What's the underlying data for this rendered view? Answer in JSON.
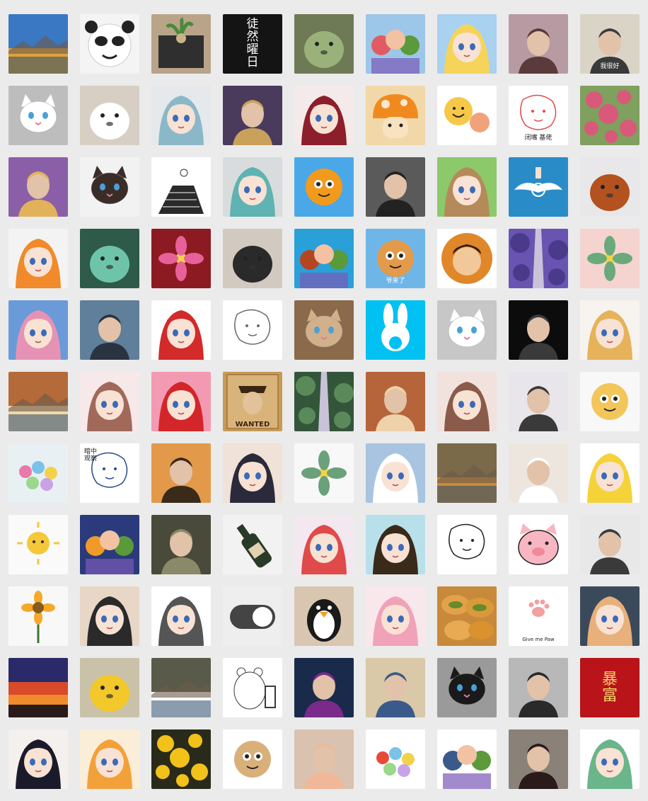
{
  "gallery": {
    "title": "",
    "columns": 9,
    "rows": 11,
    "tiles": [
      {
        "name": "blue-sky-lake-avatar",
        "bg": "#3a78c4",
        "accent": "#e0a23a",
        "shape": "landscape"
      },
      {
        "name": "panda-meme-avatar",
        "bg": "#f4f4f4",
        "accent": "#222222",
        "shape": "panda"
      },
      {
        "name": "potted-plant-table-avatar",
        "bg": "#b9a48a",
        "accent": "#2f2f2f",
        "shape": "plant"
      },
      {
        "name": "black-calligraphy-avatar",
        "bg": "#141414",
        "accent": "#ffffff",
        "shape": "text",
        "text": "徒\n然\n曜\n日"
      },
      {
        "name": "green-frog-plush-avatar",
        "bg": "#6d7a55",
        "accent": "#9ab27a",
        "shape": "blob"
      },
      {
        "name": "cartoon-kids-avatar",
        "bg": "#9cc7e8",
        "accent": "#e25a63",
        "shape": "group"
      },
      {
        "name": "sailor-moon-avatar",
        "bg": "#a9d1f0",
        "accent": "#f6d45a",
        "shape": "anime"
      },
      {
        "name": "girl-with-flower-avatar",
        "bg": "#b89aa3",
        "accent": "#5a3a3a",
        "shape": "person"
      },
      {
        "name": "old-portrait-meme-avatar",
        "bg": "#d9d4c6",
        "accent": "#3a3a3a",
        "shape": "person",
        "caption": "我很好"
      },
      {
        "name": "pixel-cat-avatar",
        "bg": "#bdbdbd",
        "accent": "#ffffff",
        "shape": "cat"
      },
      {
        "name": "white-pomeranian-avatar",
        "bg": "#d8cfc4",
        "accent": "#ffffff",
        "shape": "blob"
      },
      {
        "name": "white-hair-anime-girl-avatar",
        "bg": "#e5e9ec",
        "accent": "#8ab8c9",
        "shape": "anime"
      },
      {
        "name": "historical-general-avatar",
        "bg": "#4a3b5c",
        "accent": "#c9a15a",
        "shape": "person"
      },
      {
        "name": "red-anime-girl-avatar",
        "bg": "#f4eaea",
        "accent": "#8c1f2b",
        "shape": "anime"
      },
      {
        "name": "orange-mushroom-avatar",
        "bg": "#f2d8a8",
        "accent": "#f08a1e",
        "shape": "mushroom"
      },
      {
        "name": "cartoon-eggs-avatar",
        "bg": "#ffffff",
        "accent": "#f5c84a",
        "shape": "faces"
      },
      {
        "name": "doodle-girl-meme-avatar",
        "bg": "#ffffff",
        "accent": "#e04b4b",
        "shape": "doodle",
        "caption": "闭嘴 基佬"
      },
      {
        "name": "pink-blossom-tree-avatar",
        "bg": "#7fa05e",
        "accent": "#d9597a",
        "shape": "blossom"
      },
      {
        "name": "laughing-buddha-avatar",
        "bg": "#8b5fa8",
        "accent": "#e2b25a",
        "shape": "person"
      },
      {
        "name": "siamese-cat-avatar",
        "bg": "#f2f2f2",
        "accent": "#3a2d28",
        "shape": "cat"
      },
      {
        "name": "sketch-stairs-avatar",
        "bg": "#ffffff",
        "accent": "#333333",
        "shape": "stairs"
      },
      {
        "name": "miku-sketch-avatar",
        "bg": "#d9dcdc",
        "accent": "#5fb3b3",
        "shape": "anime"
      },
      {
        "name": "orange-mascot-avatar",
        "bg": "#4aa8e8",
        "accent": "#f39a1c",
        "shape": "mascot"
      },
      {
        "name": "sherlock-silhouette-avatar",
        "bg": "#5a5a5a",
        "accent": "#222222",
        "shape": "person"
      },
      {
        "name": "brown-hair-chibi-avatar",
        "bg": "#8cc96b",
        "accent": "#b58a5a",
        "shape": "anime"
      },
      {
        "name": "winged-compass-avatar",
        "bg": "#2a8cc7",
        "accent": "#ffffff",
        "shape": "compass"
      },
      {
        "name": "red-squirrel-avatar",
        "bg": "#e8e8ea",
        "accent": "#b3521f",
        "shape": "blob"
      },
      {
        "name": "orange-hair-anime-avatar",
        "bg": "#f3f3f3",
        "accent": "#f08a2a",
        "shape": "anime"
      },
      {
        "name": "green-blob-creature-avatar",
        "bg": "#2e5a4a",
        "accent": "#6ec4a8",
        "shape": "blob"
      },
      {
        "name": "pink-lily-bouquet-avatar",
        "bg": "#8c1a22",
        "accent": "#e8609a",
        "shape": "flower"
      },
      {
        "name": "fluffy-dog-bow-avatar",
        "bg": "#d2c9c0",
        "accent": "#2a2a2a",
        "shape": "blob"
      },
      {
        "name": "orange-sky-jump-avatar",
        "bg": "#2aa0d8",
        "accent": "#b4461f",
        "shape": "group"
      },
      {
        "name": "old-man-cloud-avatar",
        "bg": "#6fb6e8",
        "accent": "#e39a4a",
        "shape": "mascot",
        "caption": "爷来了"
      },
      {
        "name": "round-boy-emblem-avatar",
        "bg": "#ffffff",
        "accent": "#e0872a",
        "shape": "emblem"
      },
      {
        "name": "purple-forest-road-avatar",
        "bg": "#7a63c8",
        "accent": "#4a3a8a",
        "shape": "forest"
      },
      {
        "name": "pink-watercolor-avatar",
        "bg": "#f5d3cf",
        "accent": "#6aaa7a",
        "shape": "flower"
      },
      {
        "name": "pink-hair-hat-girl-avatar",
        "bg": "#6a9ad8",
        "accent": "#e592b5",
        "shape": "anime"
      },
      {
        "name": "seaside-man-avatar",
        "bg": "#5f7f9a",
        "accent": "#2a3340",
        "shape": "person"
      },
      {
        "name": "pink-hair-red-boots-avatar",
        "bg": "#ffffff",
        "accent": "#d32a2a",
        "shape": "anime"
      },
      {
        "name": "monochrome-sketch-avatar",
        "bg": "#ffffff",
        "accent": "#6a6a6a",
        "shape": "doodle"
      },
      {
        "name": "kitten-paw-avatar",
        "bg": "#8a6a4a",
        "accent": "#d1b08a",
        "shape": "cat"
      },
      {
        "name": "white-rabbit-logo-avatar",
        "bg": "#00c1f2",
        "accent": "#ffffff",
        "shape": "rabbit"
      },
      {
        "name": "gray-cat-avatar",
        "bg": "#c7c7c7",
        "accent": "#ffffff",
        "shape": "cat"
      },
      {
        "name": "dark-silhouette-avatar",
        "bg": "#0c0c0c",
        "accent": "#3a3a3a",
        "shape": "person"
      },
      {
        "name": "sunhat-girl-avatar",
        "bg": "#f7f3ee",
        "accent": "#e6b25a",
        "shape": "anime"
      },
      {
        "name": "autumn-town-avatar",
        "bg": "#b56a3a",
        "accent": "#f2d7aa",
        "shape": "landscape"
      },
      {
        "name": "cat-girl-sketch-avatar",
        "bg": "#f7e8ea",
        "accent": "#a0695a",
        "shape": "anime"
      },
      {
        "name": "ariel-avatar",
        "bg": "#f39ab3",
        "accent": "#d3262a",
        "shape": "anime"
      },
      {
        "name": "wanted-poster-avatar",
        "bg": "#c79a55",
        "accent": "#3a2512",
        "shape": "poster",
        "caption": "WANTED"
      },
      {
        "name": "green-foliage-avatar",
        "bg": "#1f3a2a",
        "accent": "#5a8a5a",
        "shape": "forest"
      },
      {
        "name": "prayer-man-avatar",
        "bg": "#b6653a",
        "accent": "#f0d2aa",
        "shape": "person"
      },
      {
        "name": "bear-ear-girl-avatar",
        "bg": "#f2e2dd",
        "accent": "#8a5a4a",
        "shape": "anime"
      },
      {
        "name": "long-hair-girl-avatar",
        "bg": "#e8e6ea",
        "accent": "#3a3a3a",
        "shape": "person"
      },
      {
        "name": "sheep-cartoon-avatar",
        "bg": "#f8f8f8",
        "accent": "#f2c65a",
        "shape": "mascot"
      },
      {
        "name": "candy-jar-avatar",
        "bg": "#e8f0f3",
        "accent": "#e87aa8",
        "shape": "candy"
      },
      {
        "name": "peeking-man-meme-avatar",
        "bg": "#ffffff",
        "accent": "#2a4a8a",
        "shape": "doodle",
        "caption": "暗中\n观察"
      },
      {
        "name": "city-walk-avatar",
        "bg": "#e29a4a",
        "accent": "#3a2a1a",
        "shape": "person"
      },
      {
        "name": "black-hair-anime-girl-avatar",
        "bg": "#f0e2d8",
        "accent": "#2a2a3a",
        "shape": "anime"
      },
      {
        "name": "flower-sketch-avatar",
        "bg": "#f8f8f8",
        "accent": "#6aa07a",
        "shape": "flower"
      },
      {
        "name": "white-hair-boy-avatar",
        "bg": "#a8c4e0",
        "accent": "#ffffff",
        "shape": "anime"
      },
      {
        "name": "street-painting-avatar",
        "bg": "#7a6a4a",
        "accent": "#c98a3a",
        "shape": "landscape"
      },
      {
        "name": "lace-dress-girl-avatar",
        "bg": "#ece6df",
        "accent": "#ffffff",
        "shape": "person"
      },
      {
        "name": "masked-boy-avatar",
        "bg": "#ffffff",
        "accent": "#f5d23a",
        "shape": "anime"
      },
      {
        "name": "sun-doodle-avatar",
        "bg": "#fafafa",
        "accent": "#f5c83a",
        "shape": "sun"
      },
      {
        "name": "armored-hero-avatar",
        "bg": "#2a3a7a",
        "accent": "#f09a2a",
        "shape": "group"
      },
      {
        "name": "soldier-avatar",
        "bg": "#4a4a3a",
        "accent": "#8a8a6a",
        "shape": "person"
      },
      {
        "name": "molotov-bottle-avatar",
        "bg": "#f2f2f2",
        "accent": "#2a3a2a",
        "shape": "bottle"
      },
      {
        "name": "red-hair-idol-avatar",
        "bg": "#f3e8f0",
        "accent": "#e04a4a",
        "shape": "anime"
      },
      {
        "name": "braided-girl-avatar",
        "bg": "#b8e0ea",
        "accent": "#3a2a1a",
        "shape": "anime"
      },
      {
        "name": "line-art-avatar",
        "bg": "#ffffff",
        "accent": "#222222",
        "shape": "doodle"
      },
      {
        "name": "pink-pig-avatar",
        "bg": "#ffffff",
        "accent": "#f7b6c2",
        "shape": "pig"
      },
      {
        "name": "dark-hair-profile-avatar",
        "bg": "#e8e8e8",
        "accent": "#3a3a3a",
        "shape": "person"
      },
      {
        "name": "sunflower-avatar",
        "bg": "#f8f8f8",
        "accent": "#f5a82a",
        "shape": "sunflower"
      },
      {
        "name": "glasses-girl-sketch-avatar",
        "bg": "#e8d6c6",
        "accent": "#2a2a2a",
        "shape": "anime"
      },
      {
        "name": "cat-ear-sketch-avatar",
        "bg": "#ffffff",
        "accent": "#555555",
        "shape": "anime"
      },
      {
        "name": "toggle-switch-avatar",
        "bg": "#eeeeee",
        "accent": "#444444",
        "shape": "toggle"
      },
      {
        "name": "penguin-plush-avatar",
        "bg": "#d9c6b0",
        "accent": "#1a1a1a",
        "shape": "penguin"
      },
      {
        "name": "pink-hair-chibi-avatar",
        "bg": "#f8e8ec",
        "accent": "#f0a2b8",
        "shape": "anime"
      },
      {
        "name": "bread-buns-avatar",
        "bg": "#c88a3a",
        "accent": "#6a8a2a",
        "shape": "bread"
      },
      {
        "name": "cat-paw-avatar",
        "bg": "#ffffff",
        "accent": "#f2a0a0",
        "shape": "paw",
        "caption": "Give me Paw"
      },
      {
        "name": "astronaut-girl-avatar",
        "bg": "#3a4a5a",
        "accent": "#e8b07a",
        "shape": "anime"
      },
      {
        "name": "sunset-sky-avatar",
        "bg": "#2a2a6a",
        "accent": "#f08a2a",
        "shape": "sunset"
      },
      {
        "name": "lamb-daffodils-avatar",
        "bg": "#c9c2a8",
        "accent": "#f2c82a",
        "shape": "blob"
      },
      {
        "name": "white-sneakers-avatar",
        "bg": "#5a5a4a",
        "accent": "#ffffff",
        "shape": "landscape"
      },
      {
        "name": "polar-bear-chair-avatar",
        "bg": "#ffffff",
        "accent": "#3a3a3a",
        "shape": "bear"
      },
      {
        "name": "masked-hero-avatar",
        "bg": "#1a2a4a",
        "accent": "#7a2a8a",
        "shape": "person"
      },
      {
        "name": "tattooed-man-avatar",
        "bg": "#d9c9a8",
        "accent": "#3a5a8a",
        "shape": "person"
      },
      {
        "name": "sleeping-cat-avatar",
        "bg": "#9a9a9a",
        "accent": "#1a1a1a",
        "shape": "cat"
      },
      {
        "name": "mirror-selfie-avatar",
        "bg": "#b8b8b8",
        "accent": "#2a2a2a",
        "shape": "person"
      },
      {
        "name": "red-fortune-avatar",
        "bg": "#b8141a",
        "accent": "#f5d46a",
        "shape": "text",
        "text": "暴\n富"
      },
      {
        "name": "long-hair-drawn-girl-avatar",
        "bg": "#f4f0ee",
        "accent": "#1a1a2a",
        "shape": "anime"
      },
      {
        "name": "grid-girl-avatar",
        "bg": "#fbeed8",
        "accent": "#f2a13a",
        "shape": "anime"
      },
      {
        "name": "yellow-flowers-avatar",
        "bg": "#2a2a1a",
        "accent": "#f2c21a",
        "shape": "blossom"
      },
      {
        "name": "bunny-gamer-avatar",
        "bg": "#ffffff",
        "accent": "#d9b07a",
        "shape": "mascot"
      },
      {
        "name": "baby-bath-avatar",
        "bg": "#d9c2b0",
        "accent": "#f0b898",
        "shape": "person"
      },
      {
        "name": "food-doodles-avatar",
        "bg": "#ffffff",
        "accent": "#e84a3a",
        "shape": "candy"
      },
      {
        "name": "family-photo-meme-avatar",
        "bg": "#ffffff",
        "accent": "#3a5a8a",
        "shape": "group"
      },
      {
        "name": "street-girl-avatar",
        "bg": "#8a8278",
        "accent": "#2a1a1a",
        "shape": "person"
      },
      {
        "name": "green-kimono-chibi-avatar",
        "bg": "#ffffff",
        "accent": "#6ab58a",
        "shape": "anime"
      }
    ]
  }
}
